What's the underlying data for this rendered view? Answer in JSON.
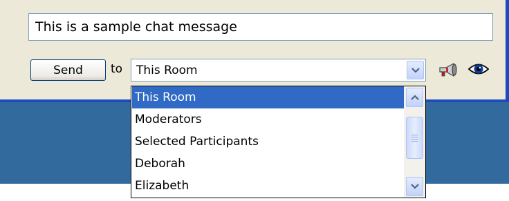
{
  "message": {
    "value": "This is a sample chat message"
  },
  "send_button": {
    "label": "Send"
  },
  "recipient": {
    "to_label": "to",
    "selected": "This Room",
    "options": [
      "This Room",
      "Moderators",
      "Selected Participants",
      "Deborah",
      "Elizabeth"
    ]
  },
  "icons": {
    "broadcast": "megaphone-icon",
    "view": "eye-icon",
    "dropdown_arrow": "chevron-down-icon",
    "scroll_up": "chevron-up-icon",
    "scroll_down": "chevron-down-icon"
  },
  "colors": {
    "panel_bg": "#ece9d8",
    "selection_blue": "#316ac5",
    "window_blue": "#1c4bc0",
    "background_blue": "#336a9e"
  }
}
